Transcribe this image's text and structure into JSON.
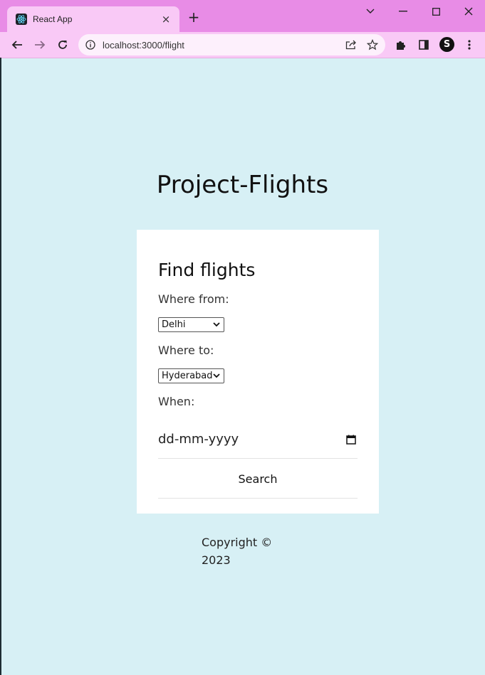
{
  "browser": {
    "tab_title": "React App",
    "tab_close": "×",
    "new_tab": "+",
    "url": "localhost:3000/flight",
    "profile_initial": "S"
  },
  "icons": {
    "favicon": "react-logo",
    "back": "arrow-left",
    "forward": "arrow-right",
    "reload": "reload",
    "site_info": "info-circle",
    "share": "share",
    "bookmark": "star",
    "extensions": "puzzle",
    "side_panel": "side-panel",
    "menu": "kebab-menu"
  },
  "page": {
    "title": "Project-Flights"
  },
  "form": {
    "heading": "Find flights",
    "from_label": "Where from:",
    "from_value": "Delhi",
    "to_label": "Where to:",
    "to_value": "Hyderabad",
    "when_label": "When:",
    "date_placeholder": "dd-mm-yyyy",
    "search_label": "Search"
  },
  "footer": {
    "copyright": "Copyright © 2023"
  },
  "colors": {
    "page_bg": "#d7f0f5",
    "chrome_titlebar": "#e88ce6",
    "chrome_toolbar": "#f9c9f6",
    "card_bg": "#ffffff"
  }
}
